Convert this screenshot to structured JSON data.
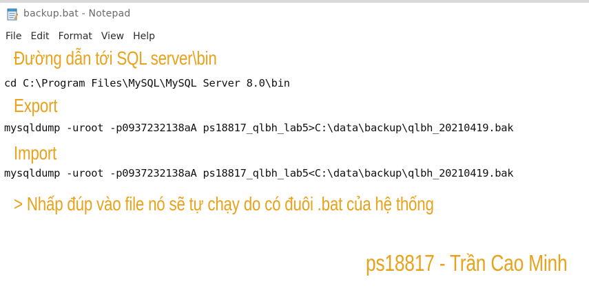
{
  "window": {
    "title": "backup.bat - Notepad"
  },
  "menu": [
    "File",
    "Edit",
    "Format",
    "View",
    "Help"
  ],
  "annotations": {
    "path_heading": "Đường dẫn tới SQL server\\bin",
    "export_heading": "Export",
    "import_heading": "Import",
    "note": "> Nhấp đúp vào file nó sẽ tự chạy do có đuôi .bat của hệ thống",
    "signature": "ps18817 - Trần Cao Minh"
  },
  "lines": {
    "cd": "cd C:\\Program Files\\MySQL\\MySQL Server 8.0\\bin",
    "export_cmd": "mysqldump -uroot -p0937232138aA ps18817_qlbh_lab5>C:\\data\\backup\\qlbh_20210419.bak",
    "import_cmd": "mysqldump -uroot -p0937232138aA ps18817_qlbh_lab5<C:\\data\\backup\\qlbh_20210419.bak"
  },
  "colors": {
    "annotation": "#e8a21b",
    "text": "#111111"
  }
}
